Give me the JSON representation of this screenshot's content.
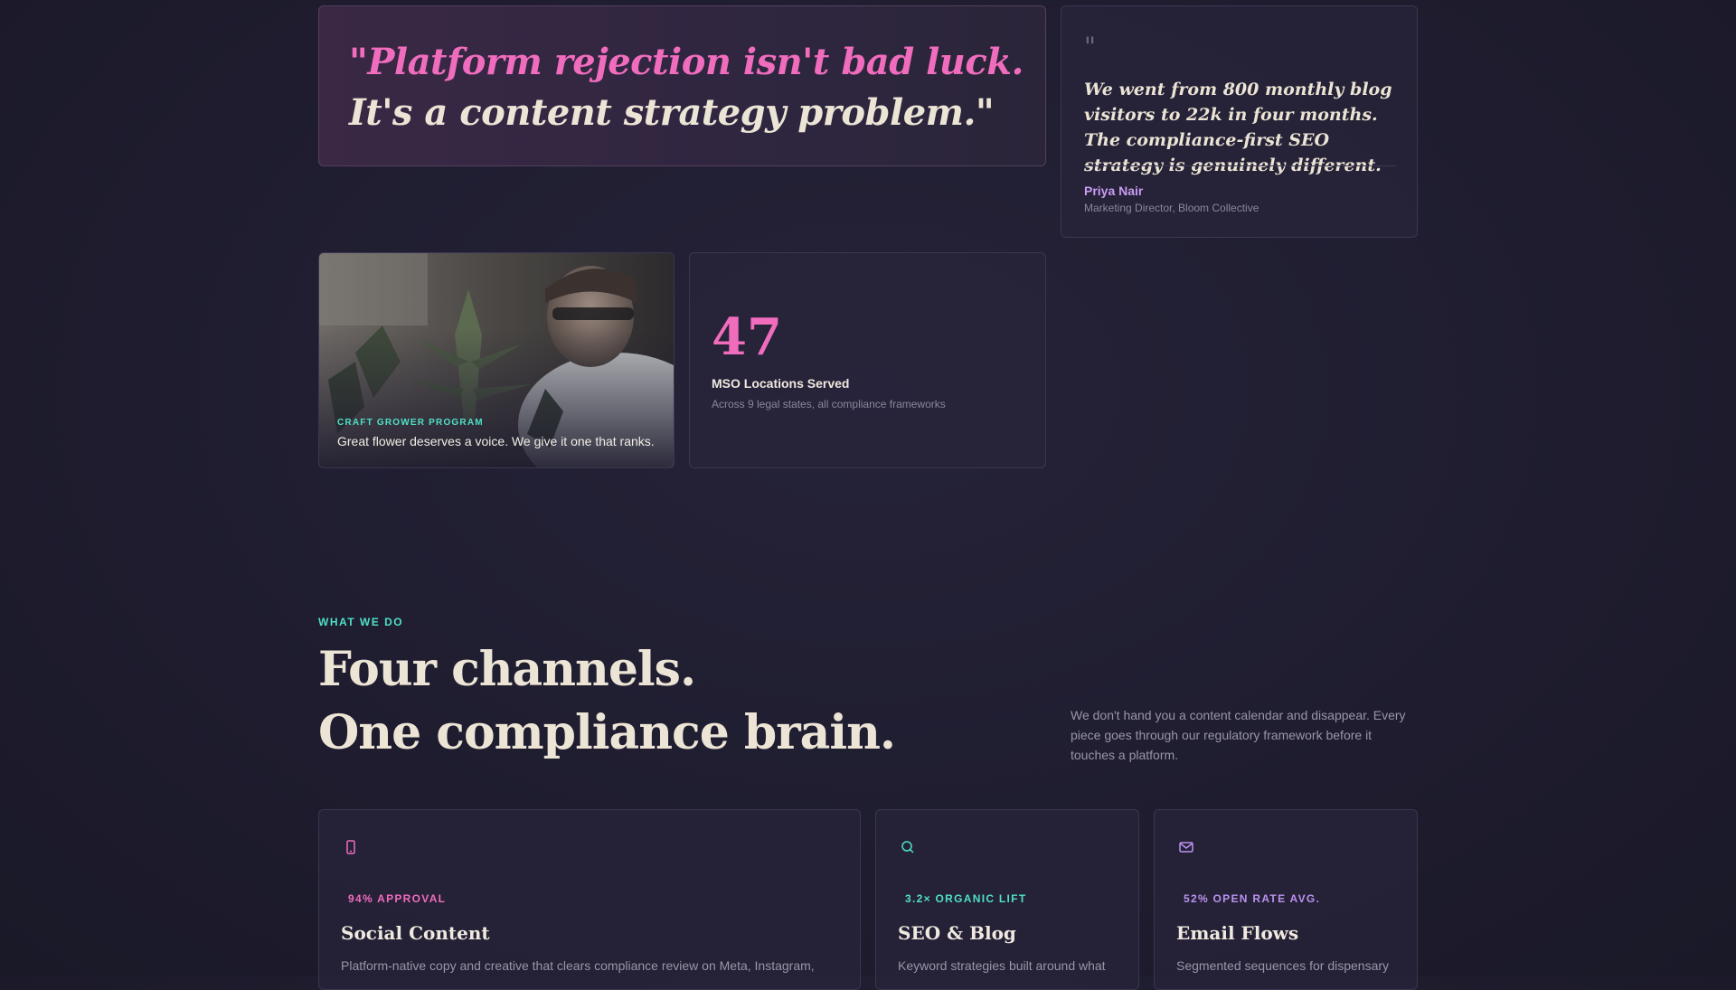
{
  "hero_quote": {
    "line1": "\"Platform rejection isn't bad luck.",
    "line2": "It's a content strategy problem.\""
  },
  "testimonial": {
    "quote_mark": "\"",
    "text": "We went from 800 monthly blog visitors to 22k in four months. The compliance-first SEO strategy is genuinely different.",
    "author": "Priya Nair",
    "role": "Marketing Director, Bloom Collective"
  },
  "photo_card": {
    "kicker": "CRAFT GROWER PROGRAM",
    "caption": "Great flower deserves a voice. We give it one that ranks."
  },
  "stat_card": {
    "number": "47",
    "label": "MSO Locations Served",
    "sub": "Across 9 legal states, all compliance frameworks"
  },
  "section": {
    "eyebrow": "WHAT WE DO",
    "headline_line1": "Four channels.",
    "headline_line2": "One compliance brain.",
    "description": "We don't hand you a content calendar and disappear. Every piece goes through our regulatory framework before it touches a platform."
  },
  "services": [
    {
      "icon": "phone-icon",
      "metric": "94% APPROVAL",
      "title": "Social Content",
      "desc": "Platform-native copy and creative that clears compliance review on Meta, Instagram,",
      "accent": "#f06cbd"
    },
    {
      "icon": "search-icon",
      "metric": "3.2× ORGANIC LIFT",
      "title": "SEO & Blog",
      "desc": "Keyword strategies built around what",
      "accent": "#4fe0c8"
    },
    {
      "icon": "mail-icon",
      "metric": "52% OPEN RATE AVG.",
      "title": "Email Flows",
      "desc": "Segmented sequences for dispensary",
      "accent": "#b993f0"
    }
  ],
  "colors": {
    "pink": "#f06cbd",
    "teal": "#4fe0c8",
    "lavender": "#b993f0",
    "cream": "#ece5d6",
    "background": "#1e1c2e"
  }
}
